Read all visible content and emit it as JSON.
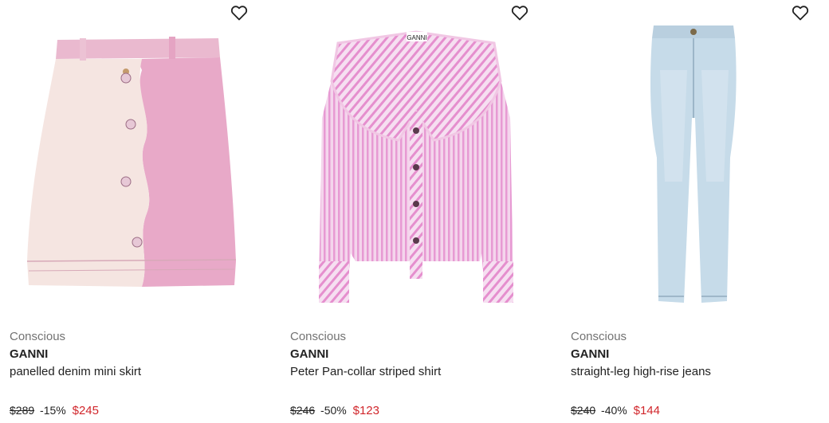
{
  "products": [
    {
      "label": "Conscious",
      "brand": "GANNI",
      "name": "panelled denim mini skirt",
      "original_price": "$289",
      "discount": "-15%",
      "sale_price": "$245",
      "wishlist_icon": "heart-outline-icon"
    },
    {
      "label": "Conscious",
      "brand": "GANNI",
      "name": "Peter Pan-collar striped shirt",
      "original_price": "$246",
      "discount": "-50%",
      "sale_price": "$123",
      "wishlist_icon": "heart-outline-icon",
      "image_tag_text": "GANNI"
    },
    {
      "label": "Conscious",
      "brand": "GANNI",
      "name": "straight-leg high-rise jeans",
      "original_price": "$240",
      "discount": "-40%",
      "sale_price": "$144",
      "wishlist_icon": "heart-outline-icon"
    }
  ],
  "colors": {
    "sale": "#d1262b",
    "label": "#727272",
    "text": "#222222"
  }
}
